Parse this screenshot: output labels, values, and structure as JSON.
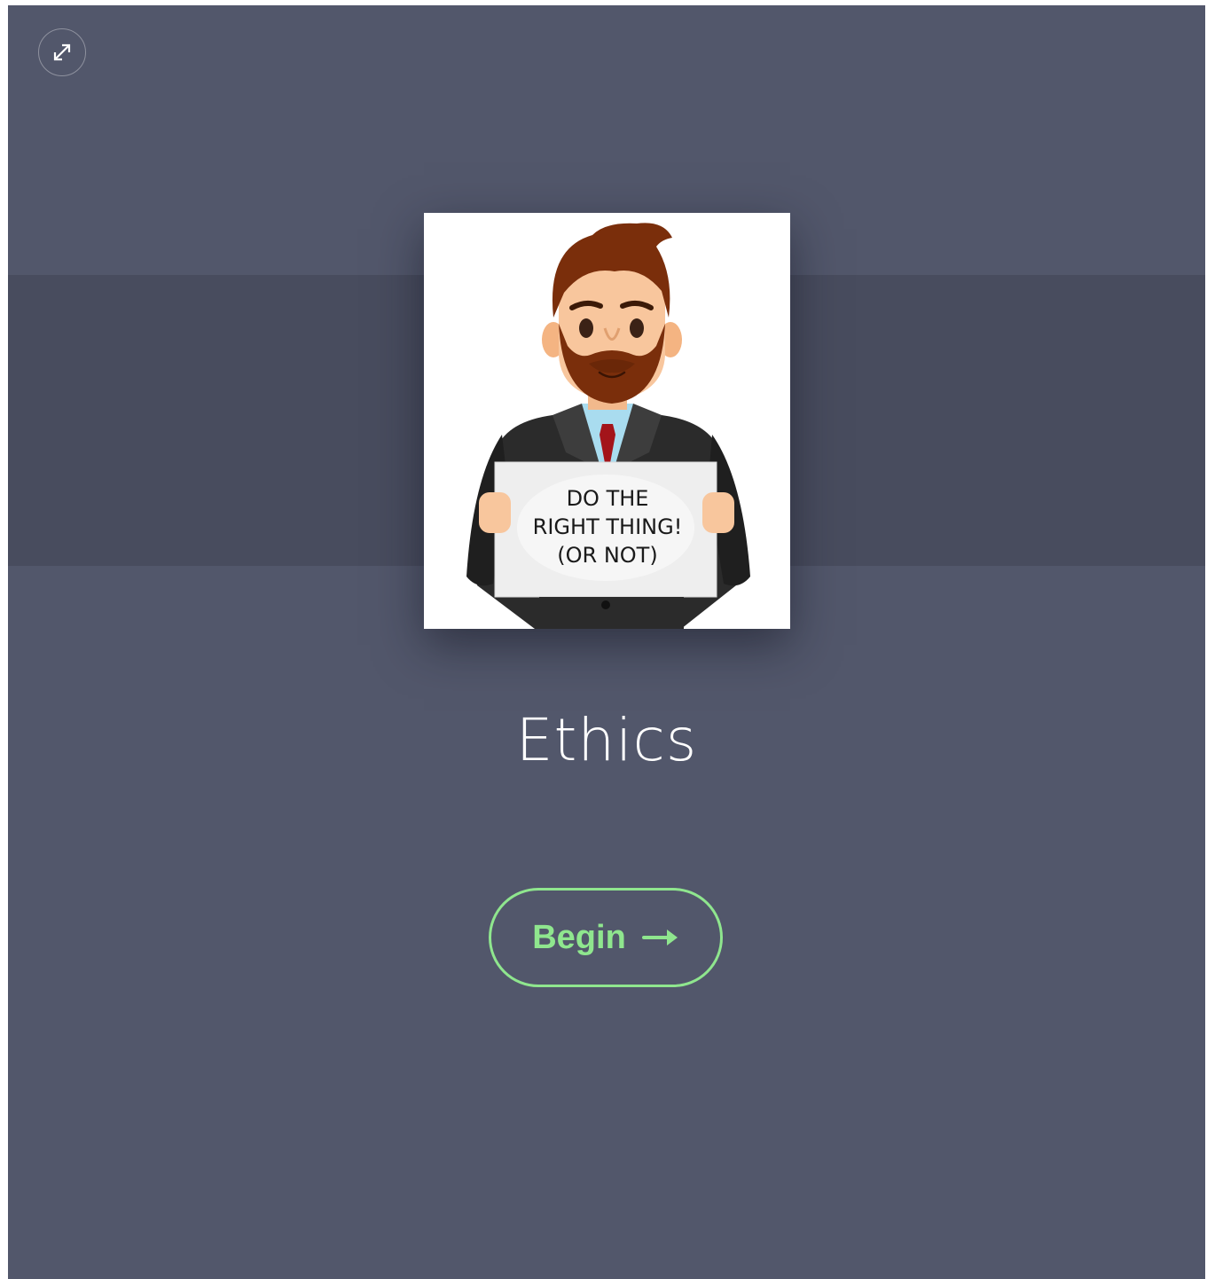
{
  "colors": {
    "background": "#52576b",
    "band": "#484c5e",
    "accent": "#8fe68e",
    "title": "#ffffff"
  },
  "toolbar": {
    "expand_icon": "expand-arrows-icon"
  },
  "cover": {
    "sign_lines": [
      "DO THE",
      "RIGHT THING!",
      "(OR NOT)"
    ]
  },
  "lesson": {
    "title": "Ethics"
  },
  "actions": {
    "begin_label": "Begin",
    "begin_icon": "arrow-right-icon"
  }
}
